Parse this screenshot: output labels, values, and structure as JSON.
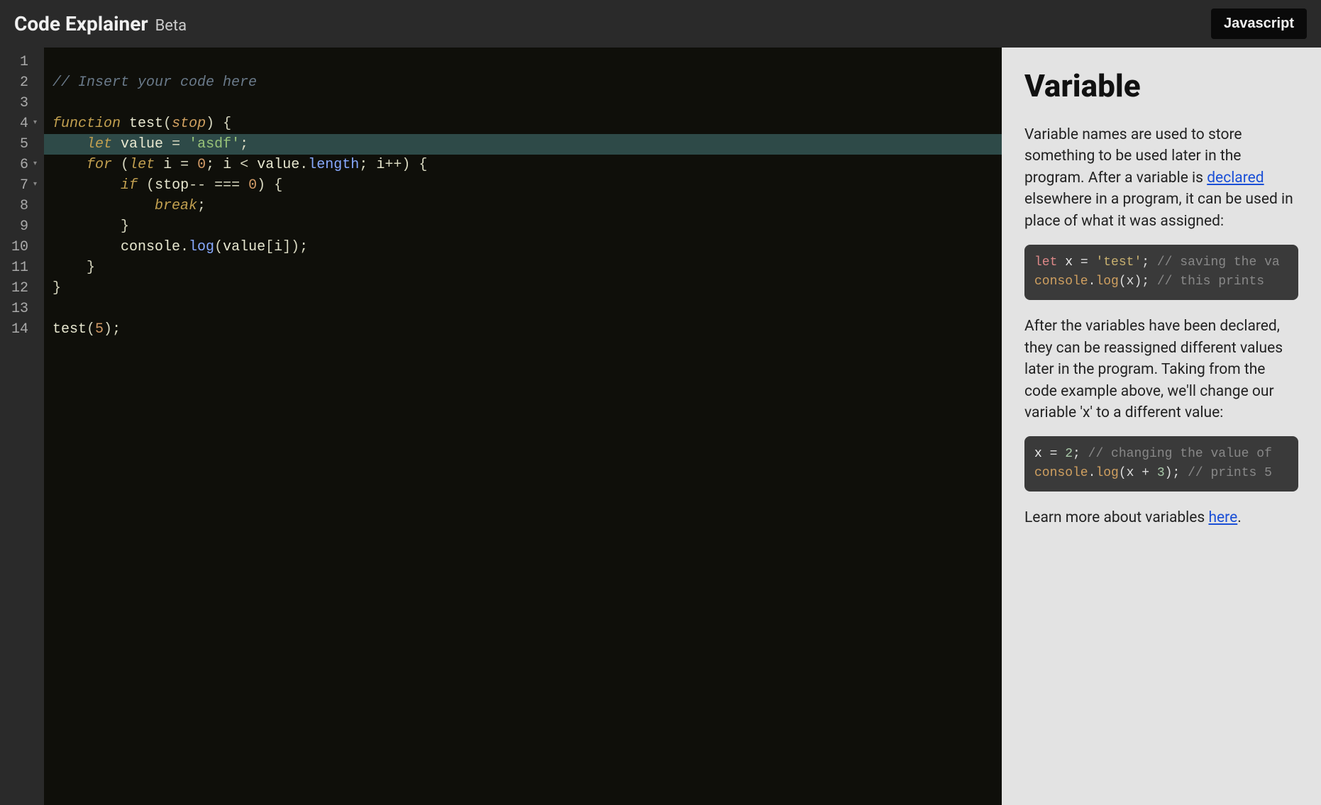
{
  "header": {
    "title": "Code Explainer",
    "beta": "Beta",
    "language": "Javascript"
  },
  "editor": {
    "highlighted_line": 5,
    "lines": [
      {
        "n": 1,
        "fold": "",
        "tokens": []
      },
      {
        "n": 2,
        "fold": "",
        "tokens": [
          {
            "cls": "tok-comment",
            "t": "// Insert your code here"
          }
        ]
      },
      {
        "n": 3,
        "fold": "",
        "tokens": []
      },
      {
        "n": 4,
        "fold": "▾",
        "tokens": [
          {
            "cls": "tok-keyword2",
            "t": "function"
          },
          {
            "cls": "",
            "t": " "
          },
          {
            "cls": "tok-funcname",
            "t": "test"
          },
          {
            "cls": "tok-paren",
            "t": "("
          },
          {
            "cls": "tok-param",
            "t": "stop"
          },
          {
            "cls": "tok-paren",
            "t": ")"
          },
          {
            "cls": "",
            "t": " "
          },
          {
            "cls": "tok-paren",
            "t": "{"
          }
        ]
      },
      {
        "n": 5,
        "fold": "",
        "tokens": [
          {
            "cls": "",
            "t": "    "
          },
          {
            "cls": "tok-let",
            "t": "let"
          },
          {
            "cls": "",
            "t": " "
          },
          {
            "cls": "tok-ident",
            "t": "value"
          },
          {
            "cls": "",
            "t": " "
          },
          {
            "cls": "tok-op",
            "t": "="
          },
          {
            "cls": "",
            "t": " "
          },
          {
            "cls": "tok-string",
            "t": "'asdf'"
          },
          {
            "cls": "tok-op",
            "t": ";"
          }
        ]
      },
      {
        "n": 6,
        "fold": "▾",
        "tokens": [
          {
            "cls": "",
            "t": "    "
          },
          {
            "cls": "tok-keyword2",
            "t": "for"
          },
          {
            "cls": "",
            "t": " "
          },
          {
            "cls": "tok-paren",
            "t": "("
          },
          {
            "cls": "tok-let",
            "t": "let"
          },
          {
            "cls": "",
            "t": " "
          },
          {
            "cls": "tok-ident",
            "t": "i"
          },
          {
            "cls": "",
            "t": " "
          },
          {
            "cls": "tok-op",
            "t": "="
          },
          {
            "cls": "",
            "t": " "
          },
          {
            "cls": "tok-number",
            "t": "0"
          },
          {
            "cls": "tok-op",
            "t": ";"
          },
          {
            "cls": "",
            "t": " "
          },
          {
            "cls": "tok-ident",
            "t": "i"
          },
          {
            "cls": "",
            "t": " "
          },
          {
            "cls": "tok-op",
            "t": "<"
          },
          {
            "cls": "",
            "t": " "
          },
          {
            "cls": "tok-ident",
            "t": "value"
          },
          {
            "cls": "tok-op",
            "t": "."
          },
          {
            "cls": "tok-prop",
            "t": "length"
          },
          {
            "cls": "tok-op",
            "t": ";"
          },
          {
            "cls": "",
            "t": " "
          },
          {
            "cls": "tok-ident",
            "t": "i"
          },
          {
            "cls": "tok-op",
            "t": "++"
          },
          {
            "cls": "tok-paren",
            "t": ")"
          },
          {
            "cls": "",
            "t": " "
          },
          {
            "cls": "tok-paren",
            "t": "{"
          }
        ]
      },
      {
        "n": 7,
        "fold": "▾",
        "tokens": [
          {
            "cls": "",
            "t": "        "
          },
          {
            "cls": "tok-keyword2",
            "t": "if"
          },
          {
            "cls": "",
            "t": " "
          },
          {
            "cls": "tok-paren",
            "t": "("
          },
          {
            "cls": "tok-ident",
            "t": "stop"
          },
          {
            "cls": "tok-op",
            "t": "--"
          },
          {
            "cls": "",
            "t": " "
          },
          {
            "cls": "tok-op",
            "t": "==="
          },
          {
            "cls": "",
            "t": " "
          },
          {
            "cls": "tok-number",
            "t": "0"
          },
          {
            "cls": "tok-paren",
            "t": ")"
          },
          {
            "cls": "",
            "t": " "
          },
          {
            "cls": "tok-paren",
            "t": "{"
          }
        ]
      },
      {
        "n": 8,
        "fold": "",
        "tokens": [
          {
            "cls": "",
            "t": "            "
          },
          {
            "cls": "tok-keyword2",
            "t": "break"
          },
          {
            "cls": "tok-op",
            "t": ";"
          }
        ]
      },
      {
        "n": 9,
        "fold": "",
        "tokens": [
          {
            "cls": "",
            "t": "        "
          },
          {
            "cls": "tok-paren",
            "t": "}"
          }
        ]
      },
      {
        "n": 10,
        "fold": "",
        "tokens": [
          {
            "cls": "",
            "t": "        "
          },
          {
            "cls": "tok-ident",
            "t": "console"
          },
          {
            "cls": "tok-op",
            "t": "."
          },
          {
            "cls": "tok-prop",
            "t": "log"
          },
          {
            "cls": "tok-paren",
            "t": "("
          },
          {
            "cls": "tok-ident",
            "t": "value"
          },
          {
            "cls": "tok-paren",
            "t": "["
          },
          {
            "cls": "tok-ident",
            "t": "i"
          },
          {
            "cls": "tok-paren",
            "t": "]"
          },
          {
            "cls": "tok-paren",
            "t": ")"
          },
          {
            "cls": "tok-op",
            "t": ";"
          }
        ]
      },
      {
        "n": 11,
        "fold": "",
        "tokens": [
          {
            "cls": "",
            "t": "    "
          },
          {
            "cls": "tok-paren",
            "t": "}"
          }
        ]
      },
      {
        "n": 12,
        "fold": "",
        "tokens": [
          {
            "cls": "tok-paren",
            "t": "}"
          }
        ]
      },
      {
        "n": 13,
        "fold": "",
        "tokens": []
      },
      {
        "n": 14,
        "fold": "",
        "tokens": [
          {
            "cls": "tok-funcname",
            "t": "test"
          },
          {
            "cls": "tok-paren",
            "t": "("
          },
          {
            "cls": "tok-number",
            "t": "5"
          },
          {
            "cls": "tok-paren",
            "t": ")"
          },
          {
            "cls": "tok-op",
            "t": ";"
          }
        ]
      }
    ]
  },
  "explain": {
    "title": "Variable",
    "para1_pre": "Variable names are used to store something to be used later in the program. After a variable is ",
    "para1_link": "declared",
    "para1_post": " elsewhere in a program, it can be used in place of what it was assigned:",
    "snippet1": [
      [
        {
          "cls": "cb-keyword",
          "t": "let"
        },
        {
          "cls": "",
          "t": " "
        },
        {
          "cls": "cb-ident",
          "t": "x"
        },
        {
          "cls": "",
          "t": " = "
        },
        {
          "cls": "cb-string",
          "t": "'test'"
        },
        {
          "cls": "",
          "t": "; "
        },
        {
          "cls": "cb-comment",
          "t": "// saving the va"
        }
      ],
      [
        {
          "cls": "cb-builtin",
          "t": "console"
        },
        {
          "cls": "",
          "t": "."
        },
        {
          "cls": "cb-builtin",
          "t": "log"
        },
        {
          "cls": "",
          "t": "(x); "
        },
        {
          "cls": "cb-comment",
          "t": "// this prints"
        }
      ]
    ],
    "para2": "After the variables have been declared, they can be reassigned different values later in the program. Taking from the code example above, we'll change our variable 'x' to a different value:",
    "snippet2": [
      [
        {
          "cls": "cb-ident",
          "t": "x"
        },
        {
          "cls": "",
          "t": " = "
        },
        {
          "cls": "cb-num",
          "t": "2"
        },
        {
          "cls": "",
          "t": "; "
        },
        {
          "cls": "cb-comment",
          "t": "// changing the value of"
        }
      ],
      [
        {
          "cls": "cb-builtin",
          "t": "console"
        },
        {
          "cls": "",
          "t": "."
        },
        {
          "cls": "cb-builtin",
          "t": "log"
        },
        {
          "cls": "",
          "t": "(x + "
        },
        {
          "cls": "cb-num",
          "t": "3"
        },
        {
          "cls": "",
          "t": "); "
        },
        {
          "cls": "cb-comment",
          "t": "// prints 5"
        }
      ]
    ],
    "para3_pre": "Learn more about variables ",
    "para3_link": "here",
    "para3_post": "."
  }
}
